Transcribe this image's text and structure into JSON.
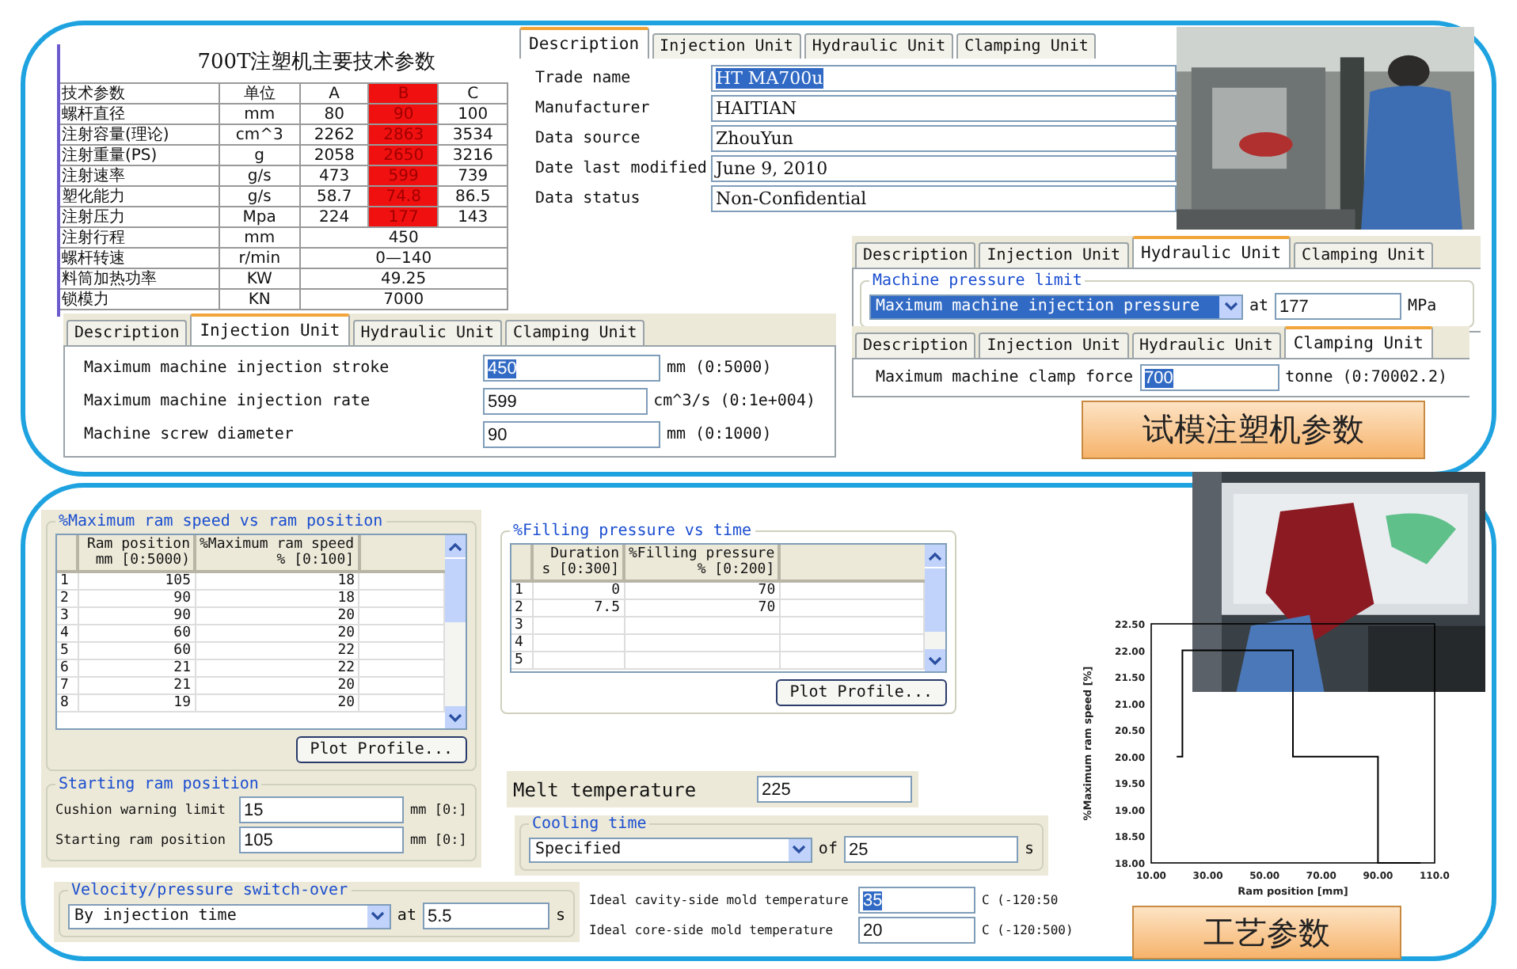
{
  "spec_sheet": {
    "title": "700T注塑机主要技术参数",
    "columns": [
      {
        "label": "技术参数",
        "highlighted": false
      },
      {
        "label": "单位",
        "highlighted": false
      },
      {
        "label": "A",
        "highlighted": false
      },
      {
        "label": "B",
        "highlighted": true
      },
      {
        "label": "C",
        "highlighted": false
      }
    ],
    "rows": [
      {
        "cells": [
          "螺杆直径",
          "mm",
          "80",
          "90",
          "100"
        ]
      },
      {
        "cells": [
          "注射容量(理论)",
          "cm^3",
          "2262",
          "2863",
          "3534"
        ]
      },
      {
        "cells": [
          "注射重量(PS)",
          "g",
          "2058",
          "2650",
          "3216"
        ]
      },
      {
        "cells": [
          "注射速率",
          "g/s",
          "473",
          "599",
          "739"
        ]
      },
      {
        "cells": [
          "塑化能力",
          "g/s",
          "58.7",
          "74.8",
          "86.5"
        ]
      },
      {
        "cells": [
          "注射压力",
          "Mpa",
          "224",
          "177",
          "143"
        ]
      },
      {
        "cells": [
          "注射行程",
          "mm",
          {
            "text": "450",
            "colspan": 3
          }
        ]
      },
      {
        "cells": [
          "螺杆转速",
          "r/min",
          {
            "text": "0—140",
            "colspan": 3
          }
        ]
      },
      {
        "cells": [
          "料筒加热功率",
          "KW",
          {
            "text": "49.25",
            "colspan": 3
          }
        ]
      },
      {
        "cells": [
          "锁模力",
          "KN",
          {
            "text": "7000",
            "colspan": 3
          }
        ]
      }
    ]
  },
  "injection_unit_panel": {
    "tabs": [
      {
        "label": "Description",
        "selected": false
      },
      {
        "label": "Injection Unit",
        "selected": true
      },
      {
        "label": "Hydraulic Unit",
        "selected": false
      },
      {
        "label": "Clamping Unit",
        "selected": false
      }
    ],
    "fields": [
      {
        "label": "Maximum machine injection stroke",
        "value": "450",
        "text_selected": true,
        "unit": "mm (0:5000)"
      },
      {
        "label": "Maximum machine injection rate",
        "value": "599",
        "text_selected": false,
        "unit": "cm^3/s (0:1e+004)"
      },
      {
        "label": "Machine screw diameter",
        "value": "90",
        "text_selected": false,
        "unit": "mm (0:1000)"
      }
    ]
  },
  "description_panel": {
    "tabs": [
      {
        "label": "Description",
        "selected": true
      },
      {
        "label": "Injection Unit",
        "selected": false
      },
      {
        "label": "Hydraulic Unit",
        "selected": false
      },
      {
        "label": "Clamping Unit",
        "selected": false
      }
    ],
    "fields": [
      {
        "label": "Trade name",
        "value": "HT MA700u",
        "text_selected": true
      },
      {
        "label": "Manufacturer",
        "value": "HAITIAN",
        "text_selected": false
      },
      {
        "label": "Data source",
        "value": "ZhouYun",
        "text_selected": false
      },
      {
        "label": "Date last modified",
        "value": "June 9, 2010",
        "text_selected": false
      },
      {
        "label": "Data status",
        "value": "Non-Confidential",
        "text_selected": false
      }
    ]
  },
  "hydraulic_panel": {
    "tabs": [
      {
        "label": "Description",
        "selected": false
      },
      {
        "label": "Injection Unit",
        "selected": false
      },
      {
        "label": "Hydraulic Unit",
        "selected": true
      },
      {
        "label": "Clamping Unit",
        "selected": false
      }
    ],
    "group_title": "Machine pressure limit",
    "dropdown": {
      "value": "Maximum machine injection pressure",
      "highlighted": true
    },
    "at_label": "at",
    "value": "177",
    "unit": "MPa"
  },
  "clamping_panel": {
    "tabs": [
      {
        "label": "Description",
        "selected": false
      },
      {
        "label": "Injection Unit",
        "selected": false
      },
      {
        "label": "Hydraulic Unit",
        "selected": false
      },
      {
        "label": "Clamping Unit",
        "selected": true
      }
    ],
    "fields": [
      {
        "label": "Maximum machine clamp force",
        "value": "700",
        "text_selected": true,
        "unit": "tonne (0:70002.2)"
      }
    ]
  },
  "caption_top": "试模注塑机参数",
  "ram_speed_profile": {
    "title": "%Maximum ram speed vs ram position",
    "columns": [
      [
        "Ram position",
        "mm [0:5000)"
      ],
      [
        "%Maximum ram speed",
        "% [0:100]"
      ]
    ],
    "rows": [
      {
        "index": "1",
        "values": [
          "105",
          "18"
        ]
      },
      {
        "index": "2",
        "values": [
          "90",
          "18"
        ]
      },
      {
        "index": "3",
        "values": [
          "90",
          "20"
        ]
      },
      {
        "index": "4",
        "values": [
          "60",
          "20"
        ]
      },
      {
        "index": "5",
        "values": [
          "60",
          "22"
        ]
      },
      {
        "index": "6",
        "values": [
          "21",
          "22"
        ]
      },
      {
        "index": "7",
        "values": [
          "21",
          "20"
        ]
      },
      {
        "index": "8",
        "values": [
          "19",
          "20"
        ]
      }
    ],
    "button": "Plot Profile..."
  },
  "starting_ram_position": {
    "title": "Starting ram position",
    "fields": [
      {
        "label": "Cushion warning limit",
        "value": "15",
        "text_selected": false,
        "unit": "mm [0:]"
      },
      {
        "label": "Starting ram position",
        "value": "105",
        "text_selected": false,
        "unit": "mm [0:]"
      }
    ]
  },
  "switch_over": {
    "title": "Velocity/pressure switch-over",
    "dropdown": {
      "value": "By injection time",
      "highlighted": false
    },
    "at_label": "at",
    "value": "5.5",
    "unit": "s"
  },
  "filling_pressure": {
    "title": "%Filling pressure vs time",
    "columns": [
      [
        "Duration",
        "s [0:300]"
      ],
      [
        "%Filling pressure",
        "% [0:200]"
      ]
    ],
    "rows": [
      {
        "index": "1",
        "values": [
          "0",
          "70"
        ]
      },
      {
        "index": "2",
        "values": [
          "7.5",
          "70"
        ]
      },
      {
        "index": "3"
      },
      {
        "index": "4"
      },
      {
        "index": "5"
      }
    ],
    "button": "Plot Profile..."
  },
  "melt_temperature": {
    "label": "Melt temperature",
    "value": "225"
  },
  "cooling_time": {
    "title": "Cooling time",
    "dropdown": {
      "value": "Specified",
      "highlighted": false
    },
    "of_label": "of",
    "value": "25",
    "unit": "s"
  },
  "mold_temperatures": {
    "fields": [
      {
        "label": "Ideal cavity-side mold temperature",
        "value": "35",
        "text_selected": true,
        "unit": "C (-120:50"
      },
      {
        "label": "Ideal core-side mold temperature",
        "value": "20",
        "text_selected": false,
        "unit": "C (-120:500)"
      }
    ]
  },
  "process_chart": {
    "chart_data": {
      "type": "line",
      "xlabel": "Ram position [mm]",
      "ylabel": "%Maximum ram speed [%]",
      "series": [
        {
          "color": "#000000",
          "values": [
            18,
            18,
            20,
            20,
            22,
            22,
            20,
            20
          ]
        }
      ],
      "x": [
        105,
        90,
        90,
        60,
        60,
        21,
        21,
        19
      ],
      "xlim": [
        10,
        110
      ],
      "ylim": [
        18,
        22.5
      ],
      "xticks": [
        {
          "value": 10,
          "label": "10.00"
        },
        {
          "value": 30,
          "label": "30.00"
        },
        {
          "value": 50,
          "label": "50.00"
        },
        {
          "value": 70,
          "label": "70.00"
        },
        {
          "value": 90,
          "label": "90.00"
        },
        {
          "value": 110,
          "label": "110.0"
        }
      ],
      "yticks": [
        {
          "value": 18,
          "label": "18.00"
        },
        {
          "value": 18.5,
          "label": "18.50"
        },
        {
          "value": 19,
          "label": "19.00"
        },
        {
          "value": 19.5,
          "label": "19.50"
        },
        {
          "value": 20,
          "label": "20.00"
        },
        {
          "value": 20.5,
          "label": "20.50"
        },
        {
          "value": 21,
          "label": "21.00"
        },
        {
          "value": 21.5,
          "label": "21.50"
        },
        {
          "value": 22,
          "label": "22.00"
        },
        {
          "value": 22.5,
          "label": "22.50"
        }
      ]
    }
  },
  "caption_bottom": "工艺参数"
}
